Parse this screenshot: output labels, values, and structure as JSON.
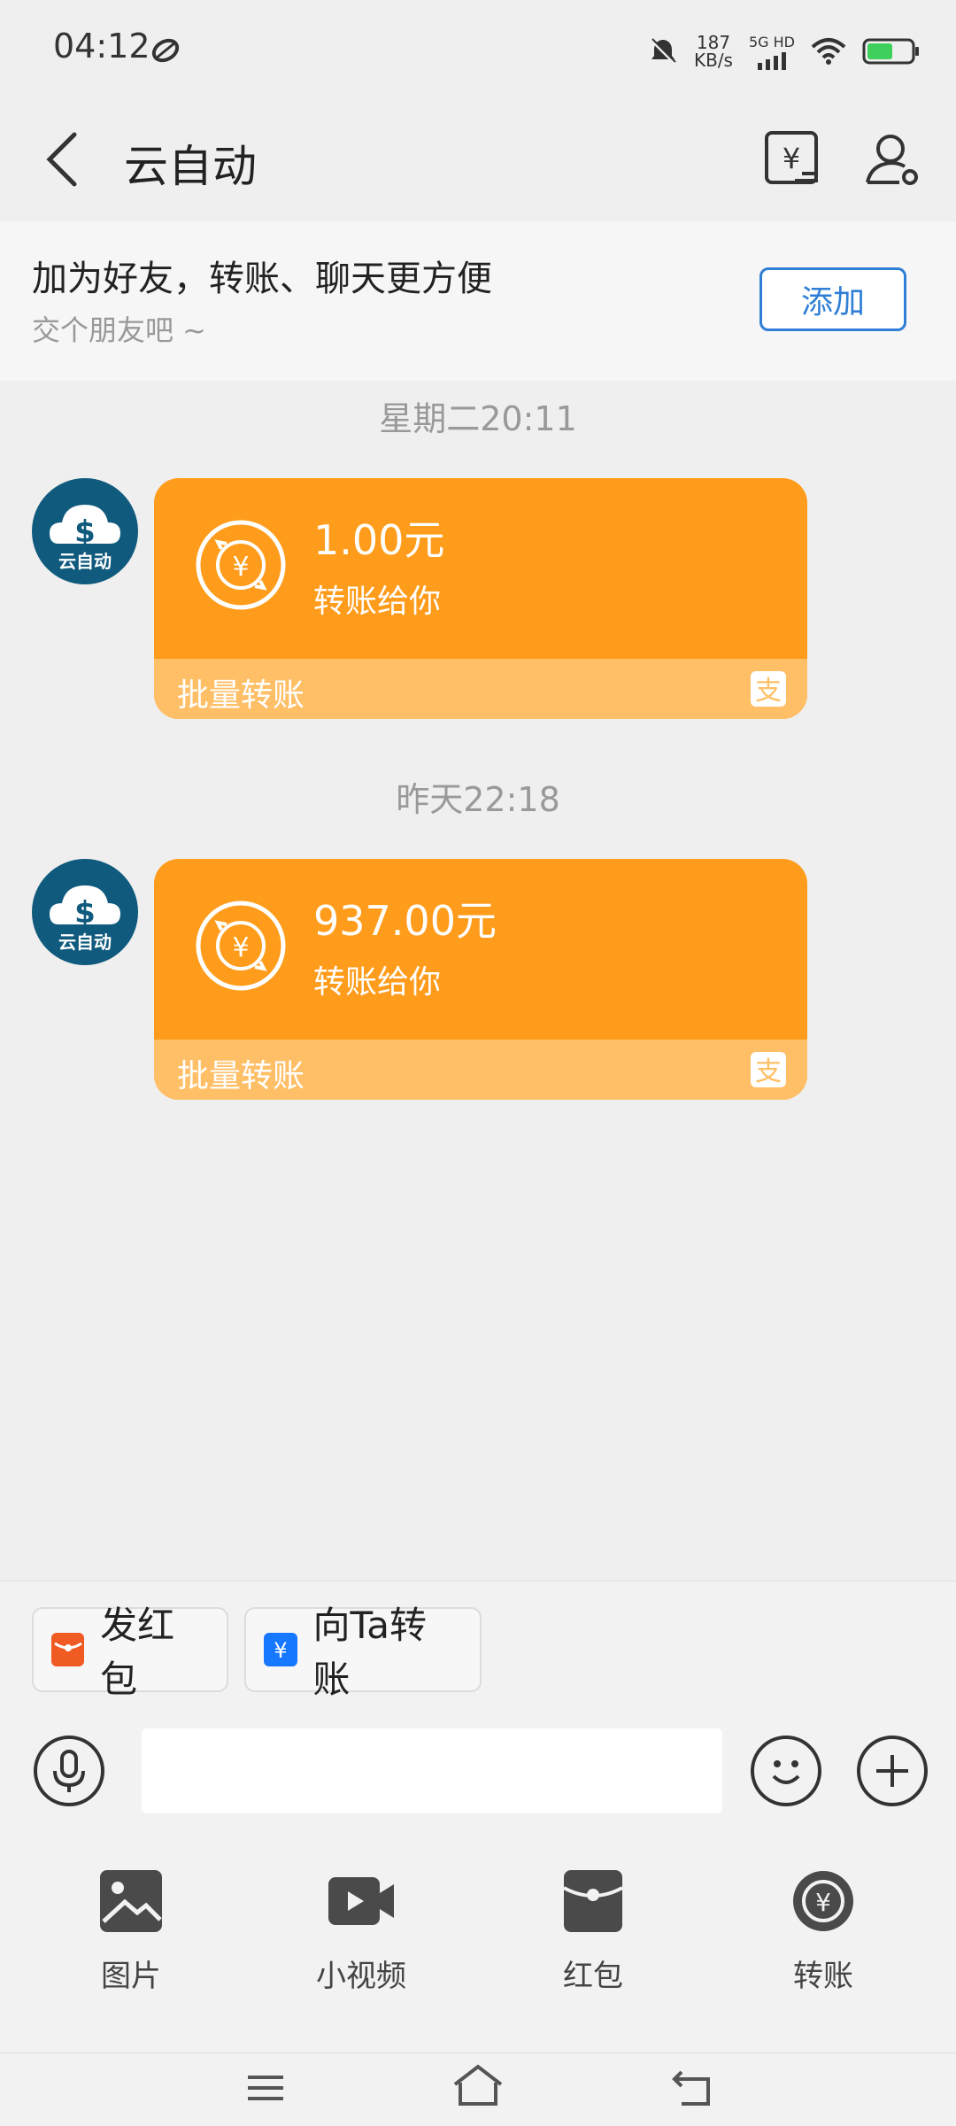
{
  "status_bar": {
    "time": "04:12",
    "net_speed_value": "187",
    "net_speed_unit": "KB/s",
    "network": "5G HD"
  },
  "header": {
    "title": "云自动",
    "icons": [
      "back-icon",
      "bill-icon",
      "profile-icon"
    ]
  },
  "banner": {
    "title": "加为好友，转账、聊天更方便",
    "subtitle": "交个朋友吧 ~",
    "add_button": "添加"
  },
  "messages": [
    {
      "time": "星期二20:11",
      "avatar_label": "云自动",
      "amount": "1.00元",
      "description": "转账给你",
      "footer": "批量转账"
    },
    {
      "time": "昨天22:18",
      "avatar_label": "云自动",
      "amount": "937.00元",
      "description": "转账给你",
      "footer": "批量转账"
    }
  ],
  "quick_actions": [
    {
      "label": "发红包",
      "color": "#f05a23"
    },
    {
      "label": "向Ta转账",
      "color": "#1677ff"
    }
  ],
  "input": {
    "placeholder": ""
  },
  "tools": [
    {
      "label": "图片",
      "icon": "image-icon"
    },
    {
      "label": "小视频",
      "icon": "video-icon"
    },
    {
      "label": "红包",
      "icon": "red-packet-icon"
    },
    {
      "label": "转账",
      "icon": "transfer-icon"
    }
  ],
  "colors": {
    "card": "#ff9c1b",
    "card_footer": "#ffbf66",
    "accent": "#2f7fd6"
  }
}
